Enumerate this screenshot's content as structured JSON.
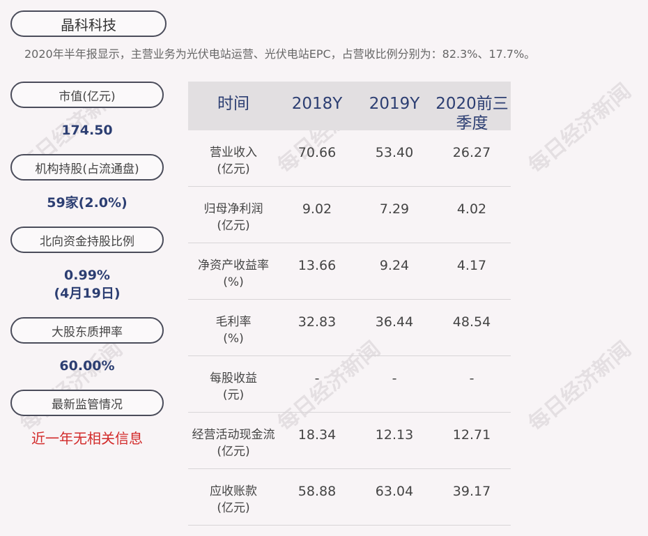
{
  "company": "晶科科技",
  "summary": "2020年半年报显示，主营业务为光伏电站运营、光伏电站EPC，占营收比例分别为：82.3%、17.7%。",
  "left": {
    "items": [
      {
        "label": "市值(亿元)",
        "value": "174.50"
      },
      {
        "label": "机构持股(占流通盘)",
        "value": "59家(2.0%)"
      },
      {
        "label": "北向资金持股比例",
        "value": "0.99%",
        "value2": "(4月19日)"
      },
      {
        "label": "大股东质押率",
        "value": "60.00%"
      },
      {
        "label": "最新监管情况",
        "value": "近一年无相关信息"
      }
    ]
  },
  "table": {
    "headers": [
      "时间",
      "2018Y",
      "2019Y",
      "2020前三",
      "季度"
    ],
    "rows": [
      {
        "label": "营业收入",
        "unit": "(亿元)",
        "values": [
          "70.66",
          "53.40",
          "26.27"
        ]
      },
      {
        "label": "归母净利润",
        "unit": "(亿元)",
        "values": [
          "9.02",
          "7.29",
          "4.02"
        ]
      },
      {
        "label": "净资产收益率",
        "unit": "(%)",
        "values": [
          "13.66",
          "9.24",
          "4.17"
        ]
      },
      {
        "label": "毛利率",
        "unit": "(%)",
        "values": [
          "32.83",
          "36.44",
          "48.54"
        ]
      },
      {
        "label": "每股收益",
        "unit": "(元)",
        "values": [
          "-",
          "-",
          "-"
        ]
      },
      {
        "label": "经营活动现金流",
        "unit": "(亿元)",
        "values": [
          "18.34",
          "12.13",
          "12.71"
        ]
      },
      {
        "label": "应收账款",
        "unit": "(亿元)",
        "values": [
          "58.88",
          "63.04",
          "39.17"
        ]
      }
    ]
  },
  "watermark": "每日经济新闻"
}
